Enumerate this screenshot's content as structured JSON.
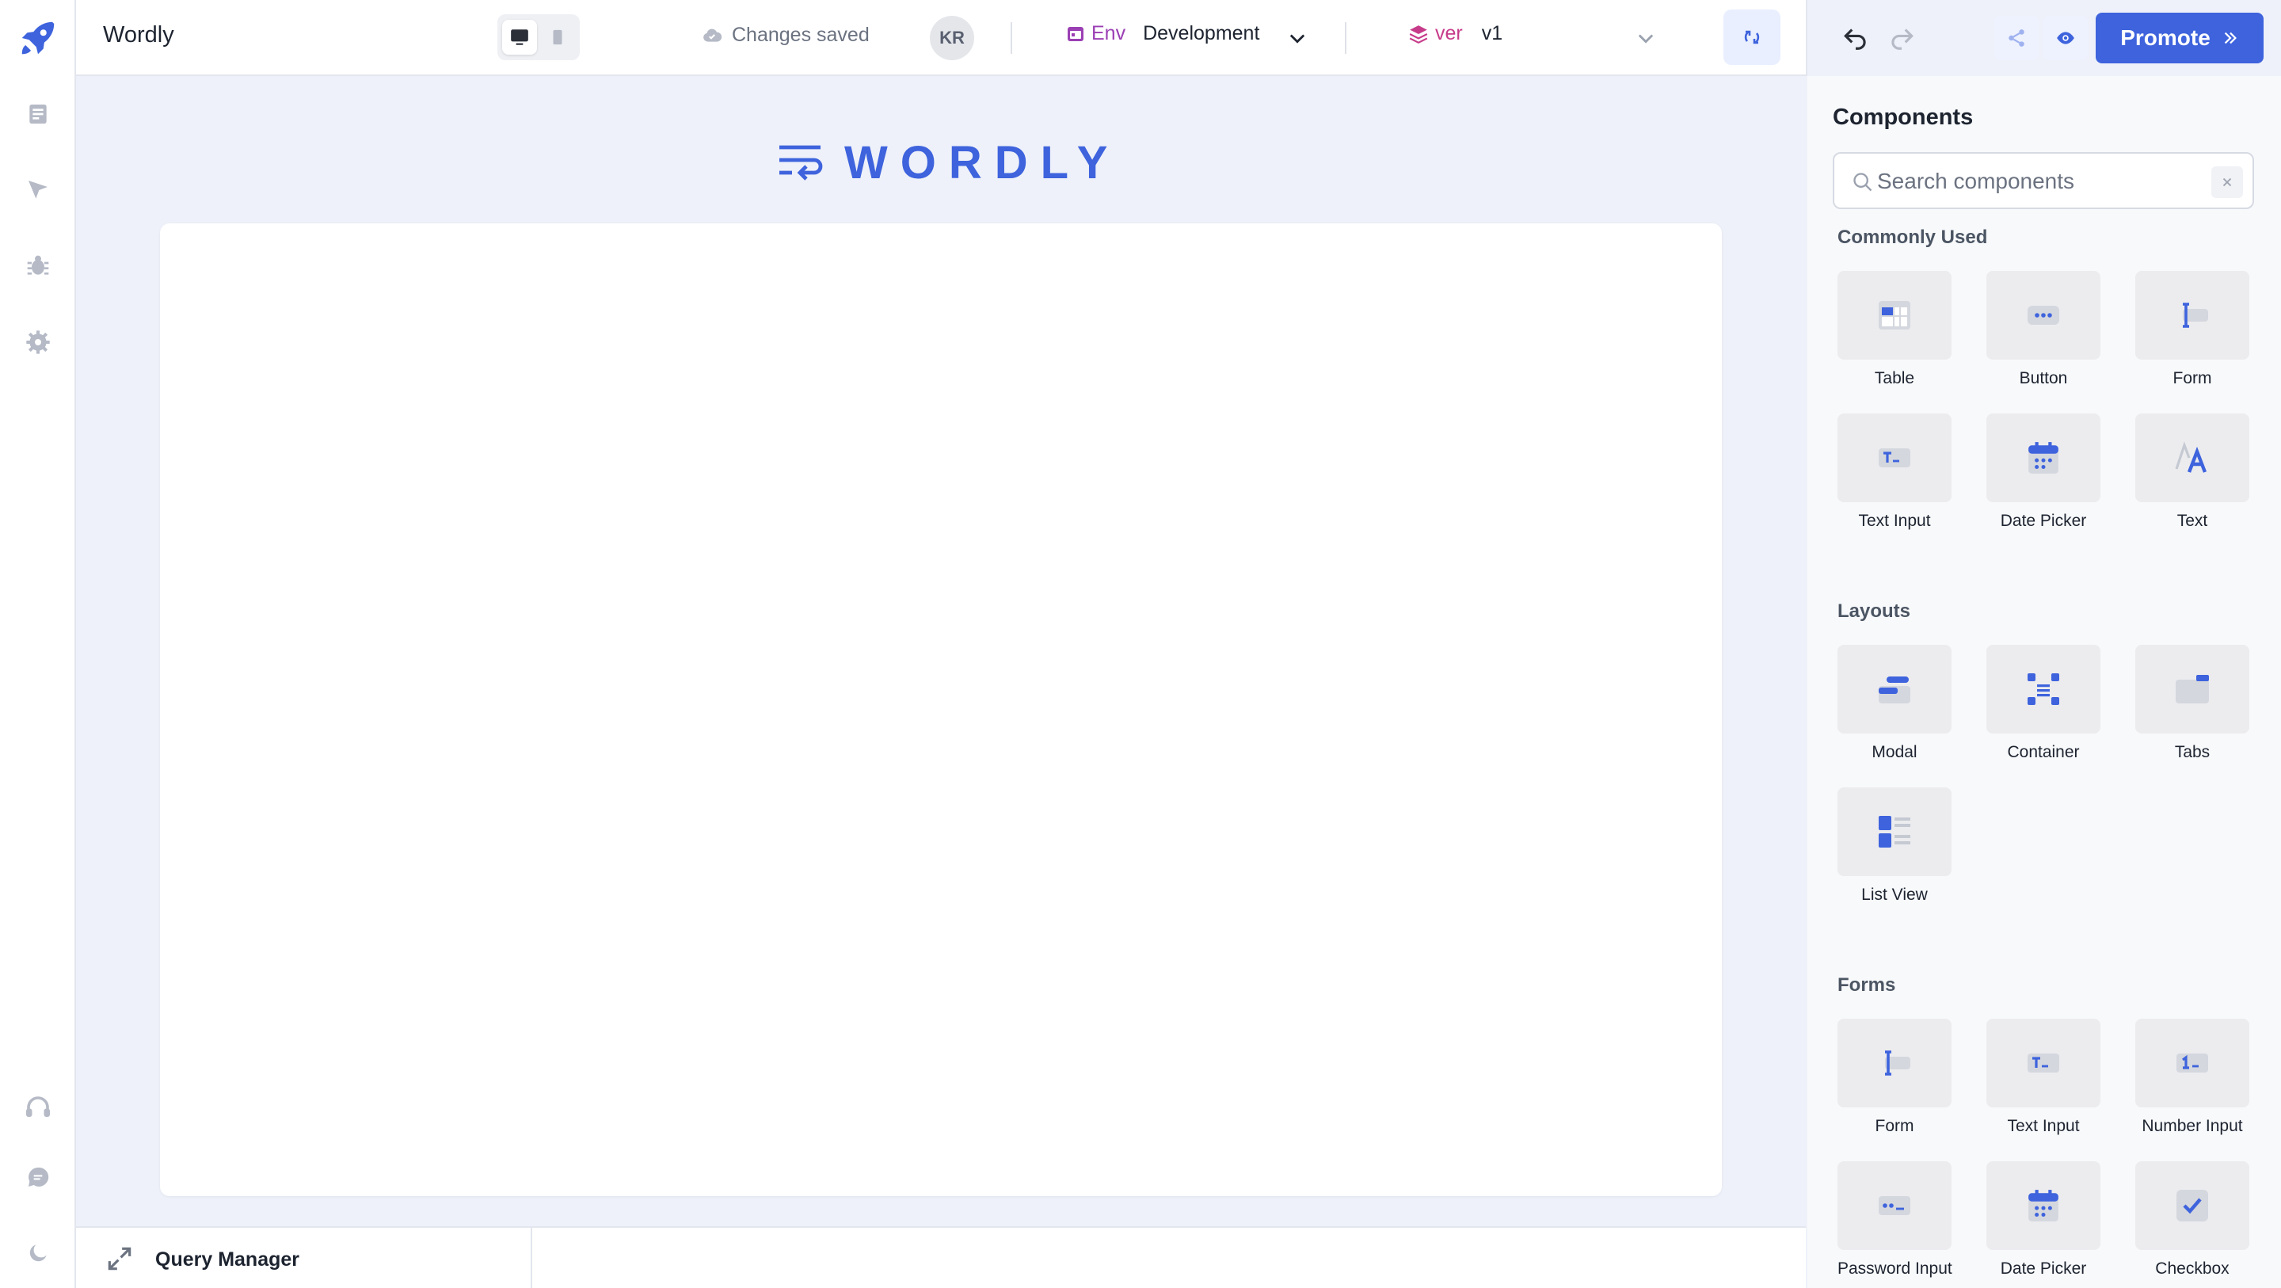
{
  "topbar": {
    "app_name": "Wordly",
    "save_status": "Changes saved",
    "avatar_initials": "KR",
    "env_label": "Env",
    "env_value": "Development",
    "version_label": "ver",
    "version_value": "v1",
    "promote_label": "Promote"
  },
  "canvas": {
    "brand": "WORDLY"
  },
  "query_manager": {
    "label": "Query Manager"
  },
  "panel": {
    "title": "Components",
    "search_placeholder": "Search components",
    "sections": {
      "commonly_used": {
        "title": "Commonly Used",
        "items": [
          "Table",
          "Button",
          "Form",
          "Text Input",
          "Date Picker",
          "Text"
        ]
      },
      "layouts": {
        "title": "Layouts",
        "items": [
          "Modal",
          "Container",
          "Tabs",
          "List View"
        ]
      },
      "forms": {
        "title": "Forms",
        "items": [
          "Form",
          "Text Input",
          "Number Input",
          "Password Input",
          "Date Picker",
          "Checkbox"
        ]
      }
    }
  },
  "colors": {
    "accent": "#3e63dd",
    "env_tag": "#9b3fb4",
    "version_tag": "#c73c8a",
    "canvas_bg": "#eef1f9"
  }
}
